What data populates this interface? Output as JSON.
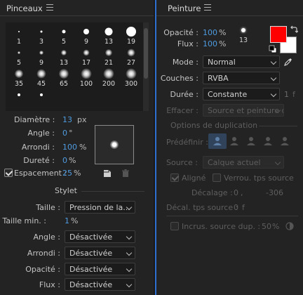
{
  "left_panel": {
    "tab_title": "Pinceaux",
    "brushes": [
      {
        "label": "1",
        "dot": 2,
        "soft": false
      },
      {
        "label": "3",
        "dot": 3,
        "soft": false
      },
      {
        "label": "5",
        "dot": 5,
        "soft": false
      },
      {
        "label": "9",
        "dot": 8,
        "soft": false
      },
      {
        "label": "13",
        "dot": 11,
        "soft": false
      },
      {
        "label": "19",
        "dot": 14,
        "soft": false
      },
      {
        "label": "5",
        "dot": 4,
        "soft": true
      },
      {
        "label": "9",
        "dot": 6,
        "soft": true
      },
      {
        "label": "13",
        "dot": 8,
        "soft": true
      },
      {
        "label": "17",
        "dot": 9,
        "soft": true
      },
      {
        "label": "21",
        "dot": 10,
        "soft": true
      },
      {
        "label": "27",
        "dot": 11,
        "soft": true
      },
      {
        "label": "35",
        "dot": 12,
        "soft": true
      },
      {
        "label": "45",
        "dot": 13,
        "soft": true
      },
      {
        "label": "65",
        "dot": 14,
        "soft": true
      },
      {
        "label": "100",
        "dot": 15,
        "soft": true
      },
      {
        "label": "200",
        "dot": 15,
        "soft": true
      },
      {
        "label": "300",
        "dot": 15,
        "soft": true
      },
      {
        "label": "",
        "dot": 4,
        "soft": false
      },
      {
        "label": "",
        "dot": 4,
        "soft": false
      }
    ],
    "diameter_label": "Diamètre :",
    "diameter_value": "13",
    "diameter_unit": "px",
    "angle_label": "Angle :",
    "angle_value": "0",
    "angle_unit": "°",
    "roundness_label": "Arrondi :",
    "roundness_value": "100",
    "roundness_unit": "%",
    "hardness_label": "Dureté :",
    "hardness_value": "0",
    "hardness_unit": "%",
    "spacing_label": "Espacement :",
    "spacing_value": "25",
    "spacing_unit": "%",
    "spacing_checked": true,
    "stylus_header": "Stylet",
    "size_label": "Taille :",
    "size_value": "Pression de la...",
    "min_size_label": "Taille min. :",
    "min_size_value": "1",
    "min_size_unit": "%",
    "angle2_label": "Angle :",
    "angle2_value": "Désactivée",
    "roundness2_label": "Arrondi :",
    "roundness2_value": "Désactivée",
    "opacity_label": "Opacité :",
    "opacity_value": "Désactivée",
    "flow_label": "Flux :",
    "flow_value": "Désactivée"
  },
  "right_panel": {
    "tab_title": "Peinture",
    "opacity_label": "Opacité :",
    "opacity_value": "100",
    "opacity_unit": "%",
    "flow_label": "Flux :",
    "flow_value": "100",
    "flow_unit": "%",
    "brush_size_label": "13",
    "foreground_color": "#ff0000",
    "background_color": "#ffffff",
    "mode_label": "Mode :",
    "mode_value": "Normal",
    "channels_label": "Couches :",
    "channels_value": "RVBA",
    "duration_label": "Durée :",
    "duration_value": "Constante",
    "duration_num": "1",
    "duration_unit": "f",
    "erase_label": "Effacer :",
    "erase_value": "Source et peinture d...",
    "clone_header": "Options de duplication",
    "preset_label": "Prédéfinir :",
    "source_label": "Source :",
    "source_value": "Calque actuel",
    "aligned_label": "Aligné",
    "aligned_checked": true,
    "lock_time_label": "Verrou. tps source",
    "lock_time_checked": false,
    "offset_label": "Décalage :",
    "offset_x": "0",
    "offset_sep": ",",
    "offset_y": "-306",
    "time_offset_label": "Décal. tps source :",
    "time_offset_value": "0",
    "time_offset_unit": "f",
    "overlay_label": "Incrus. source dup. :",
    "overlay_checked": false,
    "overlay_value": "50",
    "overlay_unit": "%"
  }
}
